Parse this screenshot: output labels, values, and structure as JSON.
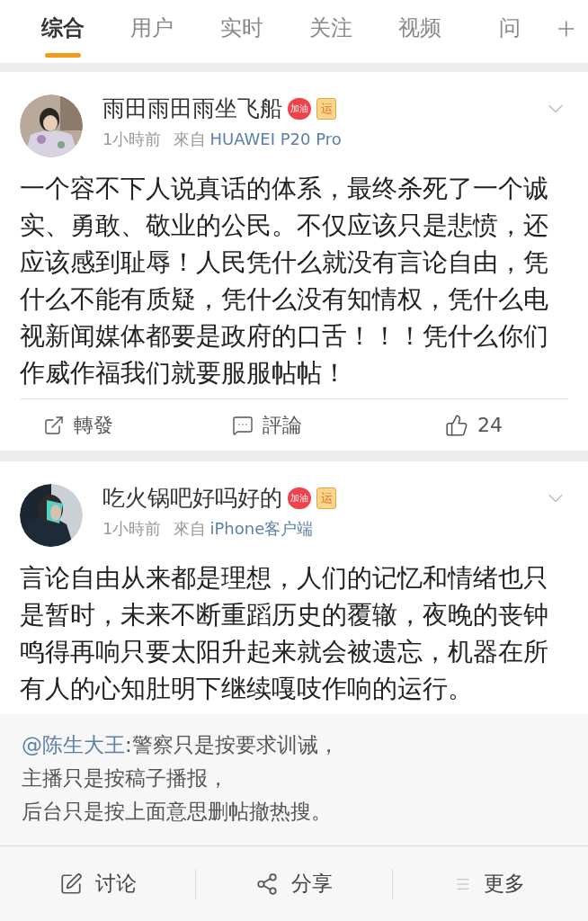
{
  "tabs": [
    {
      "label": "综合",
      "selected": true
    },
    {
      "label": "用户",
      "selected": false
    },
    {
      "label": "实时",
      "selected": false
    },
    {
      "label": "关注",
      "selected": false
    },
    {
      "label": "视频",
      "selected": false
    },
    {
      "label": "问",
      "selected": false
    }
  ],
  "posts": [
    {
      "name": "雨田雨田雨坐飞船",
      "heart_badge": "加油",
      "square_badge": "运",
      "time": "1小時前",
      "source_prefix": "來自",
      "source": "HUAWEI P20 Pro",
      "text": "一个容不下人说真话的体系，最终杀死了一个诚实、勇敢、敬业的公民。不仅应该只是悲愤，还应该感到耻辱！人民凭什么就没有言论自由，凭什么不能有质疑，凭什么没有知情权，凭什么电视新闻媒体都要是政府的口舌！！！凭什么你们作威作福我们就要服服帖帖！",
      "actions": {
        "repost": "轉發",
        "comment": "評論",
        "likes": "24"
      }
    },
    {
      "name": "吃火锅吧好吗好的",
      "heart_badge": "加油",
      "square_badge": "运",
      "time": "1小時前",
      "source_prefix": "來自",
      "source": "iPhone客户端",
      "text": "言论自由从来都是理想，人们的记忆和情绪也只是暂时，未来不断重蹈历史的覆辙，夜晚的丧钟鸣得再响只要太阳升起来就会被遗忘，机器在所有人的心知肚明下继续嘎吱作响的运行。"
    }
  ],
  "quote": {
    "mention": "@陈生大王",
    "lines": [
      ":警察只是按要求训诫，",
      "主播只是按稿子播报，",
      "后台只是按上面意思删帖撤热搜。"
    ]
  },
  "bottom_bar": [
    {
      "kind": "discuss",
      "label": "讨论"
    },
    {
      "kind": "share",
      "label": "分享"
    },
    {
      "kind": "more",
      "label": "更多"
    }
  ]
}
